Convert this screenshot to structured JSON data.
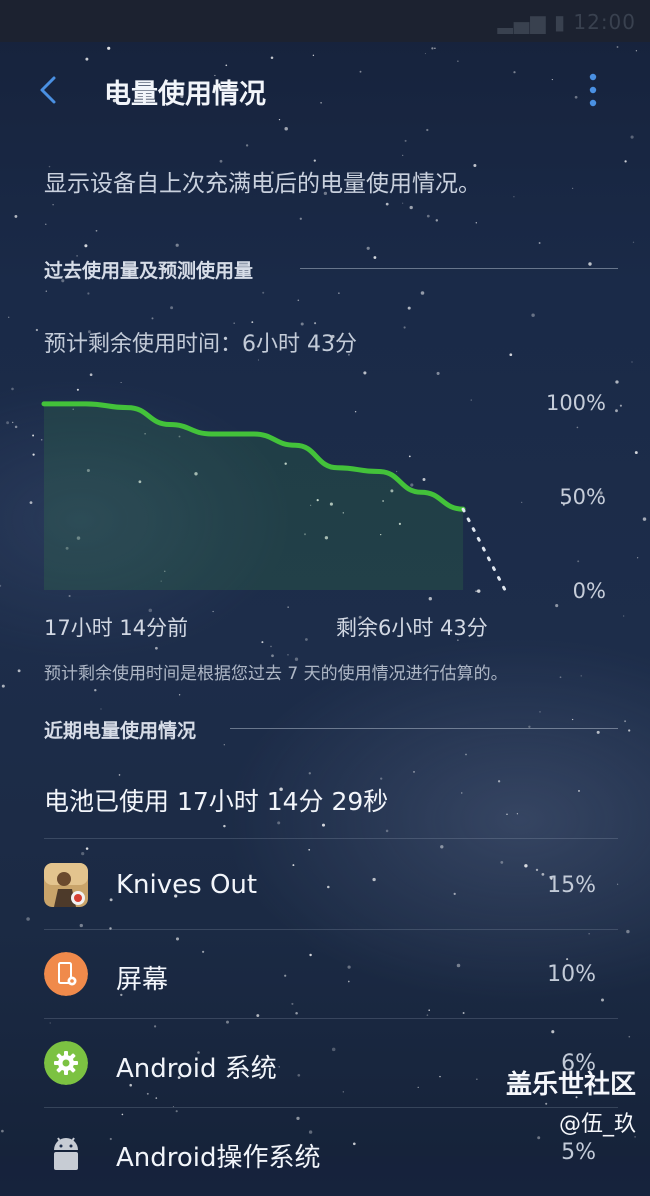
{
  "header": {
    "title": "电量使用情况"
  },
  "description": "显示设备自上次充满电后的电量使用情况。",
  "history": {
    "section_label": "过去使用量及预测使用量",
    "estimate_text": "预计剩余使用时间：6小时 43分",
    "x_start_label": "17小时 14分前",
    "x_end_label": "剩余6小时 43分",
    "note": "预计剩余使用时间是根据您过去 7 天的使用情况进行估算的。"
  },
  "chart_data": {
    "type": "line",
    "y_ticks": [
      "100%",
      "50%",
      "0%"
    ],
    "ylim": [
      0,
      100
    ],
    "grid": false,
    "series": [
      {
        "values": [
          99,
          99,
          97,
          88,
          83,
          83,
          77,
          65,
          63,
          52,
          43
        ],
        "color": "#43c23a",
        "style": "solid",
        "fill": true
      },
      {
        "values": [
          43,
          0
        ],
        "color": "#dfe6ef",
        "style": "dotted"
      }
    ]
  },
  "recent": {
    "section_label": "近期电量使用情况",
    "battery_used": "电池已使用 17小时 14分 29秒",
    "apps": [
      {
        "name": "Knives Out",
        "percent": "15%",
        "icon": "game-app-icon"
      },
      {
        "name": "屏幕",
        "percent": "10%",
        "icon": "screen-icon"
      },
      {
        "name": "Android 系统",
        "percent": "6%",
        "icon": "gear-icon"
      },
      {
        "name": "Android操作系统",
        "percent": "5%",
        "icon": "android-icon"
      }
    ]
  },
  "watermark": {
    "line1": "盖乐世社区",
    "line2": "@伍_玖"
  },
  "colors": {
    "accent": "#4a90e2",
    "curve": "#43c23a",
    "screen_icon": "#f08a4b",
    "system_icon": "#7cc242"
  }
}
